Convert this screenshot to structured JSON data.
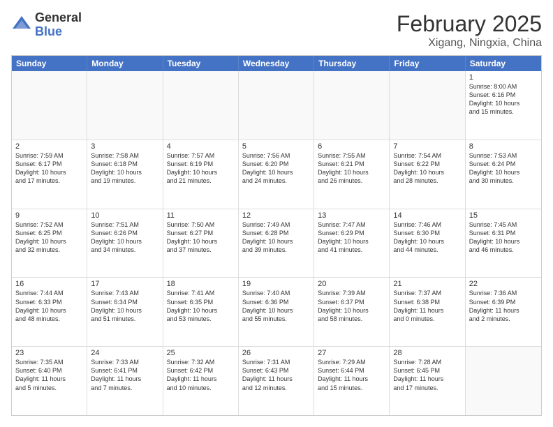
{
  "header": {
    "logo_general": "General",
    "logo_blue": "Blue",
    "month_title": "February 2025",
    "location": "Xigang, Ningxia, China"
  },
  "days_of_week": [
    "Sunday",
    "Monday",
    "Tuesday",
    "Wednesday",
    "Thursday",
    "Friday",
    "Saturday"
  ],
  "weeks": [
    [
      {
        "day": "",
        "info": ""
      },
      {
        "day": "",
        "info": ""
      },
      {
        "day": "",
        "info": ""
      },
      {
        "day": "",
        "info": ""
      },
      {
        "day": "",
        "info": ""
      },
      {
        "day": "",
        "info": ""
      },
      {
        "day": "1",
        "info": "Sunrise: 8:00 AM\nSunset: 6:16 PM\nDaylight: 10 hours\nand 15 minutes."
      }
    ],
    [
      {
        "day": "2",
        "info": "Sunrise: 7:59 AM\nSunset: 6:17 PM\nDaylight: 10 hours\nand 17 minutes."
      },
      {
        "day": "3",
        "info": "Sunrise: 7:58 AM\nSunset: 6:18 PM\nDaylight: 10 hours\nand 19 minutes."
      },
      {
        "day": "4",
        "info": "Sunrise: 7:57 AM\nSunset: 6:19 PM\nDaylight: 10 hours\nand 21 minutes."
      },
      {
        "day": "5",
        "info": "Sunrise: 7:56 AM\nSunset: 6:20 PM\nDaylight: 10 hours\nand 24 minutes."
      },
      {
        "day": "6",
        "info": "Sunrise: 7:55 AM\nSunset: 6:21 PM\nDaylight: 10 hours\nand 26 minutes."
      },
      {
        "day": "7",
        "info": "Sunrise: 7:54 AM\nSunset: 6:22 PM\nDaylight: 10 hours\nand 28 minutes."
      },
      {
        "day": "8",
        "info": "Sunrise: 7:53 AM\nSunset: 6:24 PM\nDaylight: 10 hours\nand 30 minutes."
      }
    ],
    [
      {
        "day": "9",
        "info": "Sunrise: 7:52 AM\nSunset: 6:25 PM\nDaylight: 10 hours\nand 32 minutes."
      },
      {
        "day": "10",
        "info": "Sunrise: 7:51 AM\nSunset: 6:26 PM\nDaylight: 10 hours\nand 34 minutes."
      },
      {
        "day": "11",
        "info": "Sunrise: 7:50 AM\nSunset: 6:27 PM\nDaylight: 10 hours\nand 37 minutes."
      },
      {
        "day": "12",
        "info": "Sunrise: 7:49 AM\nSunset: 6:28 PM\nDaylight: 10 hours\nand 39 minutes."
      },
      {
        "day": "13",
        "info": "Sunrise: 7:47 AM\nSunset: 6:29 PM\nDaylight: 10 hours\nand 41 minutes."
      },
      {
        "day": "14",
        "info": "Sunrise: 7:46 AM\nSunset: 6:30 PM\nDaylight: 10 hours\nand 44 minutes."
      },
      {
        "day": "15",
        "info": "Sunrise: 7:45 AM\nSunset: 6:31 PM\nDaylight: 10 hours\nand 46 minutes."
      }
    ],
    [
      {
        "day": "16",
        "info": "Sunrise: 7:44 AM\nSunset: 6:33 PM\nDaylight: 10 hours\nand 48 minutes."
      },
      {
        "day": "17",
        "info": "Sunrise: 7:43 AM\nSunset: 6:34 PM\nDaylight: 10 hours\nand 51 minutes."
      },
      {
        "day": "18",
        "info": "Sunrise: 7:41 AM\nSunset: 6:35 PM\nDaylight: 10 hours\nand 53 minutes."
      },
      {
        "day": "19",
        "info": "Sunrise: 7:40 AM\nSunset: 6:36 PM\nDaylight: 10 hours\nand 55 minutes."
      },
      {
        "day": "20",
        "info": "Sunrise: 7:39 AM\nSunset: 6:37 PM\nDaylight: 10 hours\nand 58 minutes."
      },
      {
        "day": "21",
        "info": "Sunrise: 7:37 AM\nSunset: 6:38 PM\nDaylight: 11 hours\nand 0 minutes."
      },
      {
        "day": "22",
        "info": "Sunrise: 7:36 AM\nSunset: 6:39 PM\nDaylight: 11 hours\nand 2 minutes."
      }
    ],
    [
      {
        "day": "23",
        "info": "Sunrise: 7:35 AM\nSunset: 6:40 PM\nDaylight: 11 hours\nand 5 minutes."
      },
      {
        "day": "24",
        "info": "Sunrise: 7:33 AM\nSunset: 6:41 PM\nDaylight: 11 hours\nand 7 minutes."
      },
      {
        "day": "25",
        "info": "Sunrise: 7:32 AM\nSunset: 6:42 PM\nDaylight: 11 hours\nand 10 minutes."
      },
      {
        "day": "26",
        "info": "Sunrise: 7:31 AM\nSunset: 6:43 PM\nDaylight: 11 hours\nand 12 minutes."
      },
      {
        "day": "27",
        "info": "Sunrise: 7:29 AM\nSunset: 6:44 PM\nDaylight: 11 hours\nand 15 minutes."
      },
      {
        "day": "28",
        "info": "Sunrise: 7:28 AM\nSunset: 6:45 PM\nDaylight: 11 hours\nand 17 minutes."
      },
      {
        "day": "",
        "info": ""
      }
    ]
  ]
}
